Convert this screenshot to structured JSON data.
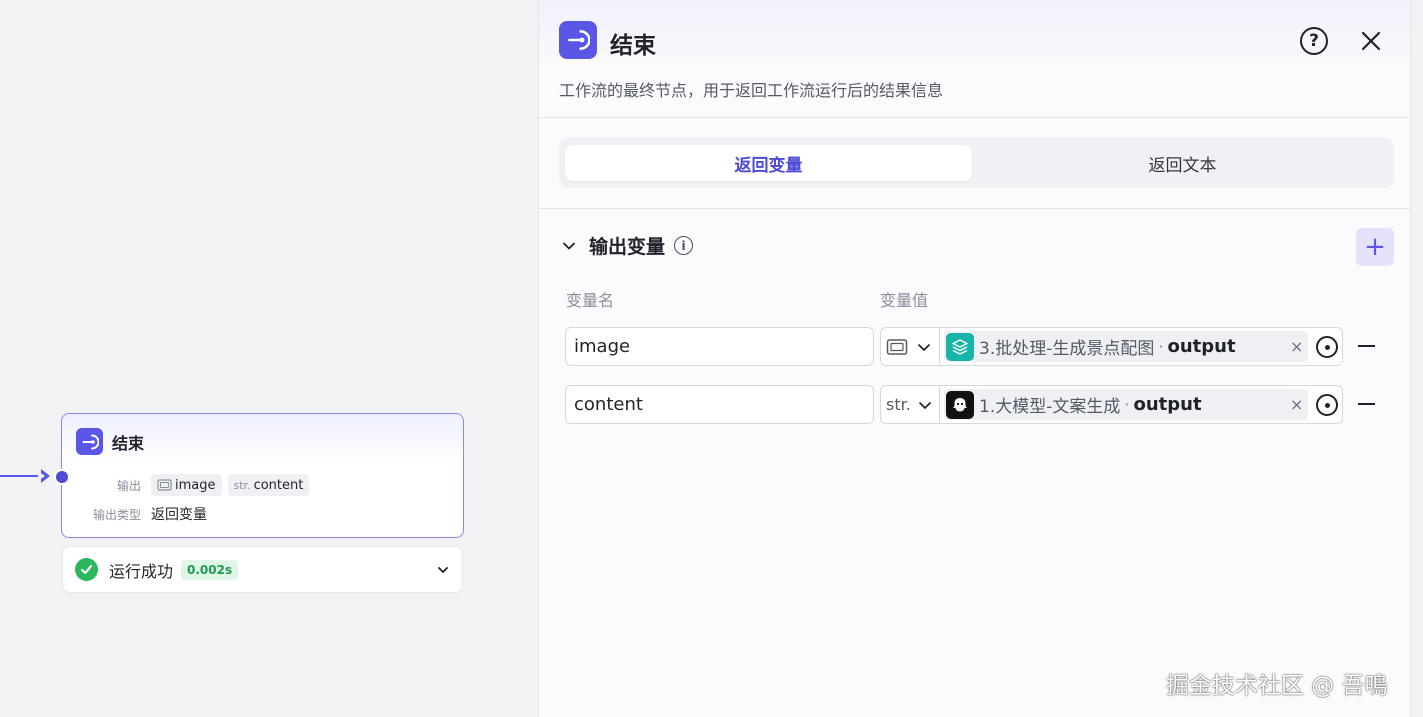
{
  "node": {
    "title": "结束",
    "output_label": "输出",
    "output_tags": [
      {
        "type": "image-icon",
        "name": "image"
      },
      {
        "type": "str.",
        "name": "content"
      }
    ],
    "output_type_label": "输出类型",
    "output_type_value": "返回变量"
  },
  "run_status": {
    "text": "运行成功",
    "duration": "0.002s"
  },
  "panel": {
    "title": "结束",
    "description": "工作流的最终节点，用于返回工作流运行后的结果信息",
    "tabs": [
      {
        "label": "返回变量",
        "active": true
      },
      {
        "label": "返回文本",
        "active": false
      }
    ],
    "section_title": "输出变量",
    "add_button": "+",
    "columns": {
      "name": "变量名",
      "value": "变量值"
    },
    "variables": [
      {
        "name": "image",
        "type": "image-icon",
        "ref_icon": "layers-icon",
        "ref_source": "3.批处理-生成景点配图",
        "ref_output": "output"
      },
      {
        "name": "content",
        "type": "str.",
        "ref_icon": "llm-bot-icon",
        "ref_source": "1.大模型-文案生成",
        "ref_output": "output"
      }
    ]
  },
  "watermark": "掘金技术社区 @ 吾鳴",
  "colors": {
    "accent": "#5a56e6",
    "success": "#2bb85d",
    "teal": "#16b5a8"
  }
}
